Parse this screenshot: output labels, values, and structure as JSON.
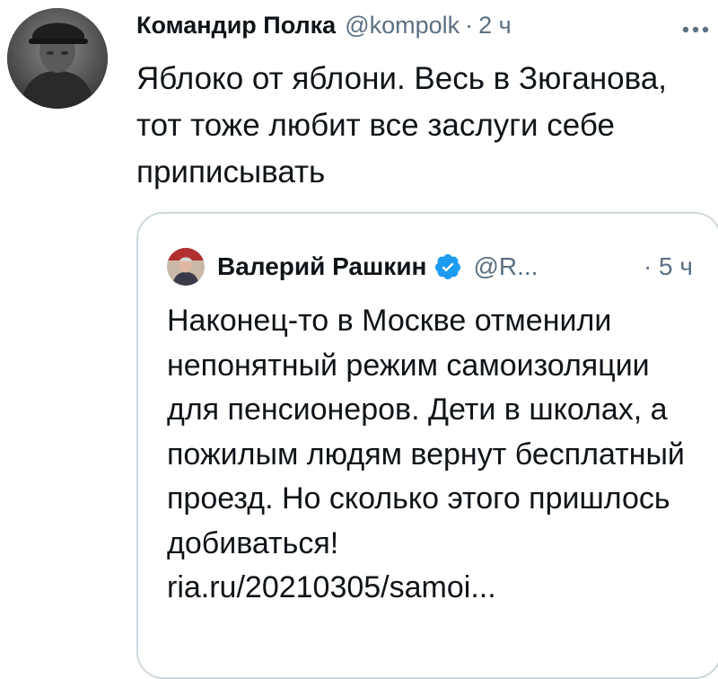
{
  "tweet": {
    "author_name": "Командир Полка",
    "author_handle": "@kompolk",
    "separator": "·",
    "time": "2 ч",
    "more_icon": "more-icon",
    "text": "Яблоко от яблони. Весь в Зюганова, тот тоже любит все заслуги себе приписывать"
  },
  "quoted": {
    "author_name": "Валерий Рашкин",
    "verified_icon": "verified-badge-icon",
    "author_handle": "@R...",
    "separator": "·",
    "time": "5 ч",
    "text": "Наконец-то в Москве отменили непонятный режим самоизоляции для пенсионеров. Дети в школах, а пожилым людям вернут бесплатный проезд. Но сколько этого пришлось добиваться!",
    "link": "ria.ru/20210305/samoi..."
  },
  "colors": {
    "text_primary": "#0f1419",
    "text_secondary": "#5b7083",
    "border": "#cfd9de",
    "verified": "#1d9bf0"
  }
}
